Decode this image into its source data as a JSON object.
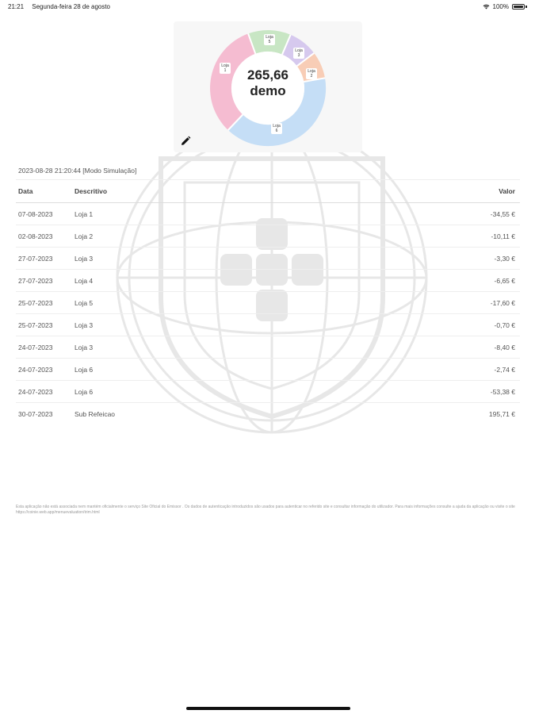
{
  "status_bar": {
    "time": "21:21",
    "date": "Segunda-feira 28 de agosto",
    "battery": "100%"
  },
  "chart": {
    "center_value": "265,66",
    "center_label": "demo",
    "colors": {
      "loja1": "#f5bcd1",
      "loja2": "#c8e6c4",
      "loja3": "#d6c9ee",
      "loja4": "#f8cdb6",
      "loja6": "#c5def6"
    },
    "slice_labels": [
      "Loja 1",
      "Loja 5",
      "Loja 3",
      "Loja 2",
      "Loja 6"
    ]
  },
  "session": "2023-08-28 21:20:44 [Modo Simulação]",
  "table": {
    "headers": {
      "date": "Data",
      "description": "Descritivo",
      "value": "Valor"
    },
    "rows": [
      {
        "date": "07-08-2023",
        "description": "Loja 1",
        "value": "-34,55 €"
      },
      {
        "date": "02-08-2023",
        "description": "Loja 2",
        "value": "-10,11 €"
      },
      {
        "date": "27-07-2023",
        "description": "Loja 3",
        "value": "-3,30 €"
      },
      {
        "date": "27-07-2023",
        "description": "Loja 4",
        "value": "-6,65 €"
      },
      {
        "date": "25-07-2023",
        "description": "Loja 5",
        "value": "-17,60 €"
      },
      {
        "date": "25-07-2023",
        "description": "Loja 3",
        "value": "-0,70 €"
      },
      {
        "date": "24-07-2023",
        "description": "Loja 3",
        "value": "-8,40 €"
      },
      {
        "date": "24-07-2023",
        "description": "Loja 6",
        "value": "-2,74 €"
      },
      {
        "date": "24-07-2023",
        "description": "Loja 6",
        "value": "-53,38 €"
      },
      {
        "date": "30-07-2023",
        "description": "Sub Refeicao",
        "value": "195,71 €"
      }
    ]
  },
  "disclaimer": "Esta aplicação não está associada nem mantém oficialmente o serviço Site Oficial do Emissor . Os dados de autenticação introduzidos são usados para autenticar no referido site e consultar informação do utilizador. Para mais informações consulte a ajuda da aplicação ou visite o site https://coinie.web.app/menuevaluation/trim.html"
}
